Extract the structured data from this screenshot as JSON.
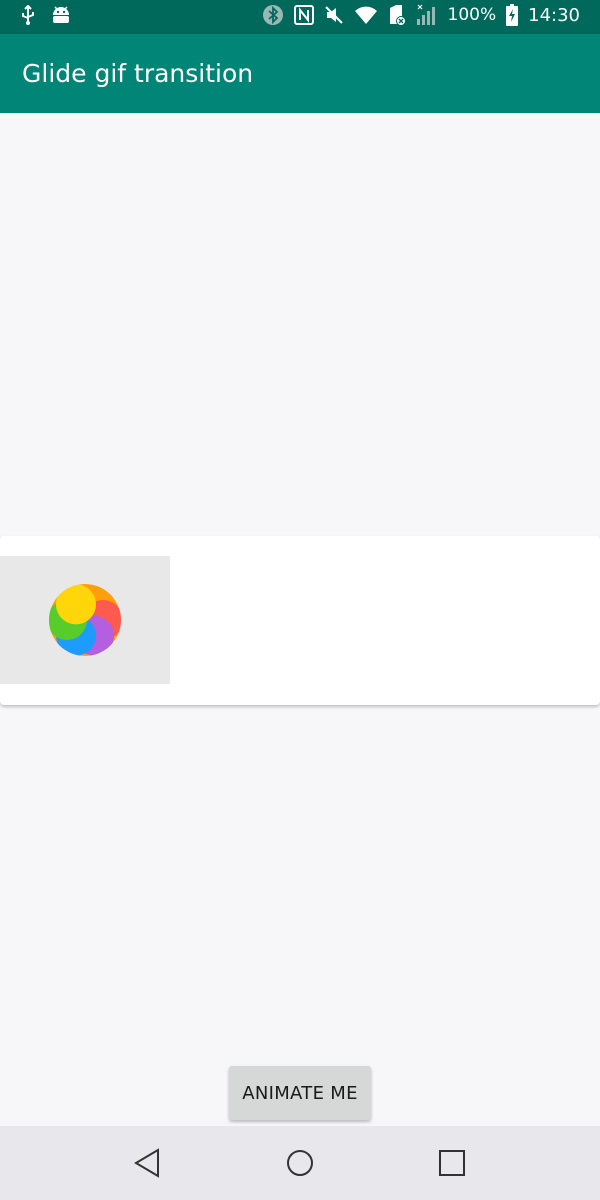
{
  "status_bar": {
    "left_icons": [
      "usb-icon",
      "android-debug-icon"
    ],
    "right_icons": [
      "bluetooth-icon",
      "nfc-icon",
      "mute-icon",
      "wifi-icon",
      "sim-icon",
      "signal-icon",
      "battery-icon"
    ],
    "battery_text": "100%",
    "time": "14:30"
  },
  "app_bar": {
    "title": "Glide gif transition"
  },
  "card": {
    "image": "pinwheel-gif",
    "pinwheel_colors": [
      "#ff9f0a",
      "#ff5a4f",
      "#b35fe0",
      "#1e9bff",
      "#58cc2a",
      "#ffd60a"
    ]
  },
  "main": {
    "animate_button_label": "ANIMATE ME"
  },
  "nav_bar": {
    "buttons": [
      "back",
      "home",
      "recents"
    ]
  },
  "colors": {
    "status_bar": "#00695c",
    "app_bar": "#008577",
    "background": "#f7f7f9",
    "button": "#d6d7d7",
    "nav_bar": "#e8e8ec"
  }
}
